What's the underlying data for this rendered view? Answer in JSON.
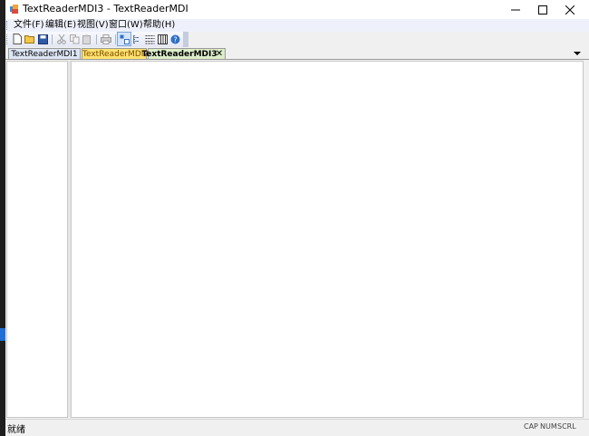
{
  "window": {
    "title": "TextReaderMDI3 - TextReaderMDI"
  },
  "menu": {
    "items": [
      {
        "label": "文件(F)"
      },
      {
        "label": "编辑(E)"
      },
      {
        "label": "视图(V)"
      },
      {
        "label": "窗口(W)"
      },
      {
        "label": "帮助(H)"
      }
    ]
  },
  "toolbar": {
    "buttons": [
      "new-file-icon",
      "open-folder-icon",
      "save-icon",
      "cut-icon",
      "copy-icon",
      "paste-icon",
      "print-icon",
      "view-icon",
      "list-icon",
      "tree-icon",
      "columns-icon",
      "help-icon"
    ]
  },
  "tabs": [
    {
      "label": "TextReaderMDI1",
      "color": "#dde6f6"
    },
    {
      "label": "TextReaderMDI2",
      "color": "#ffe26e"
    },
    {
      "label": "TextReaderMDI3",
      "color": "#dcedc8"
    }
  ],
  "status": {
    "text": "就绪",
    "indicators": [
      "CAP",
      "NUM",
      "SCRL"
    ]
  },
  "colors": {
    "titlebar": "#ffffff",
    "menubar": "#eef1fb",
    "accent_blue": "#1f6fd6"
  }
}
